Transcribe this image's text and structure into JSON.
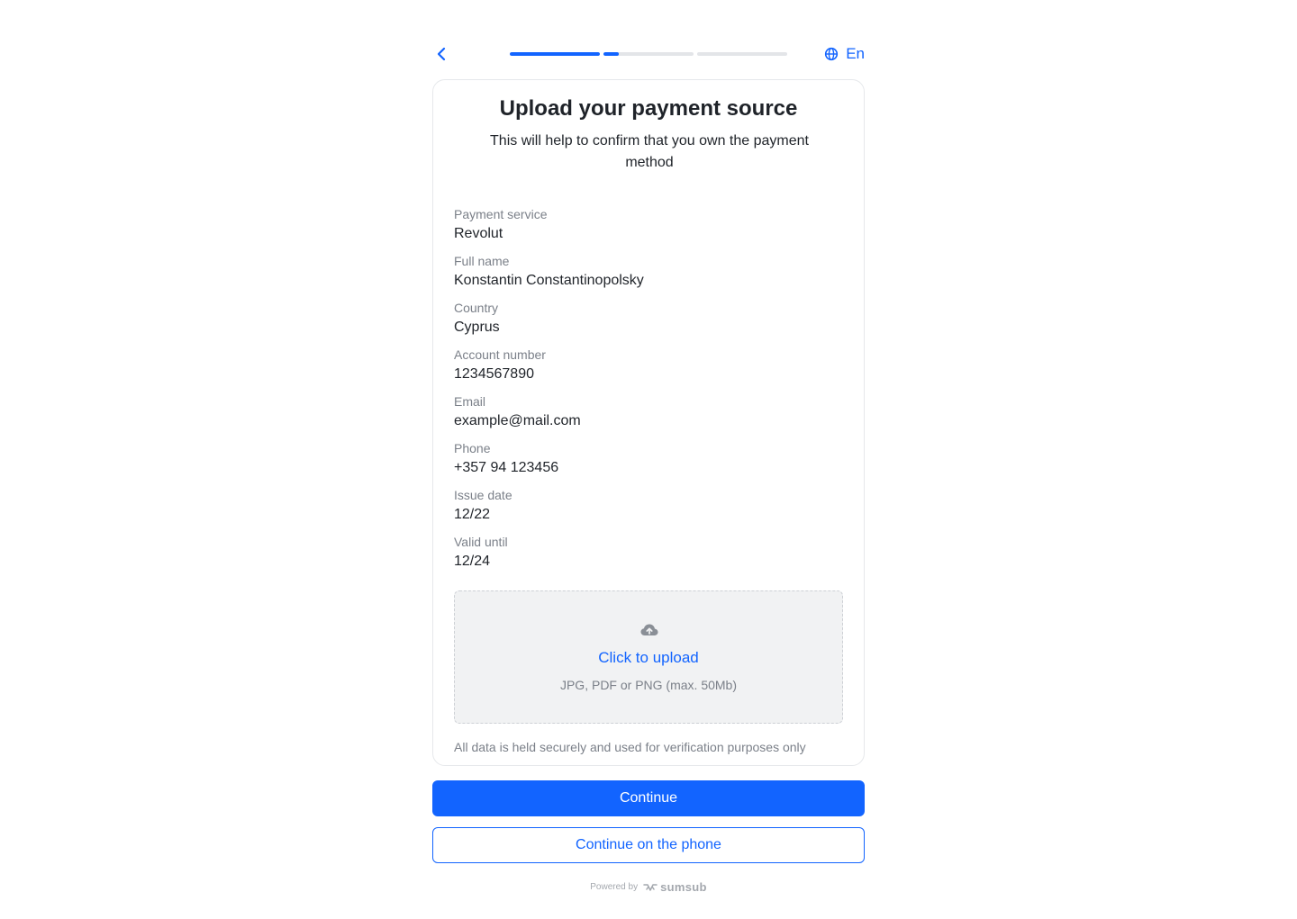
{
  "header": {
    "back_icon": "chevron-left-icon",
    "progress": [
      {
        "fill": 1.0
      },
      {
        "fill": 0.17
      },
      {
        "fill": 0.0
      }
    ],
    "language": "En",
    "language_icon": "globe-icon"
  },
  "card": {
    "title": "Upload your payment source",
    "subtitle": "This will help to confirm that you own the payment method",
    "fields": [
      {
        "label": "Payment service",
        "value": "Revolut"
      },
      {
        "label": "Full name",
        "value": "Konstantin Constantinopolsky"
      },
      {
        "label": "Country",
        "value": "Cyprus"
      },
      {
        "label": "Account number",
        "value": "1234567890"
      },
      {
        "label": "Email",
        "value": "example@mail.com"
      },
      {
        "label": "Phone",
        "value": "+357 94 123456"
      },
      {
        "label": "Issue date",
        "value": "12/22"
      },
      {
        "label": "Valid until",
        "value": "12/24"
      }
    ],
    "upload": {
      "icon": "cloud-upload-icon",
      "link": "Click to upload",
      "hint": "JPG, PDF or PNG (max. 50Mb)"
    },
    "secure_note": "All data is held securely and used for verification purposes only"
  },
  "actions": {
    "continue": "Continue",
    "continue_phone": "Continue on the phone"
  },
  "footer": {
    "powered_by": "Powered by",
    "brand": "sumsub"
  },
  "colors": {
    "accent": "#1264ff",
    "muted_text": "#7b8089",
    "upload_bg": "#f1f2f3"
  }
}
